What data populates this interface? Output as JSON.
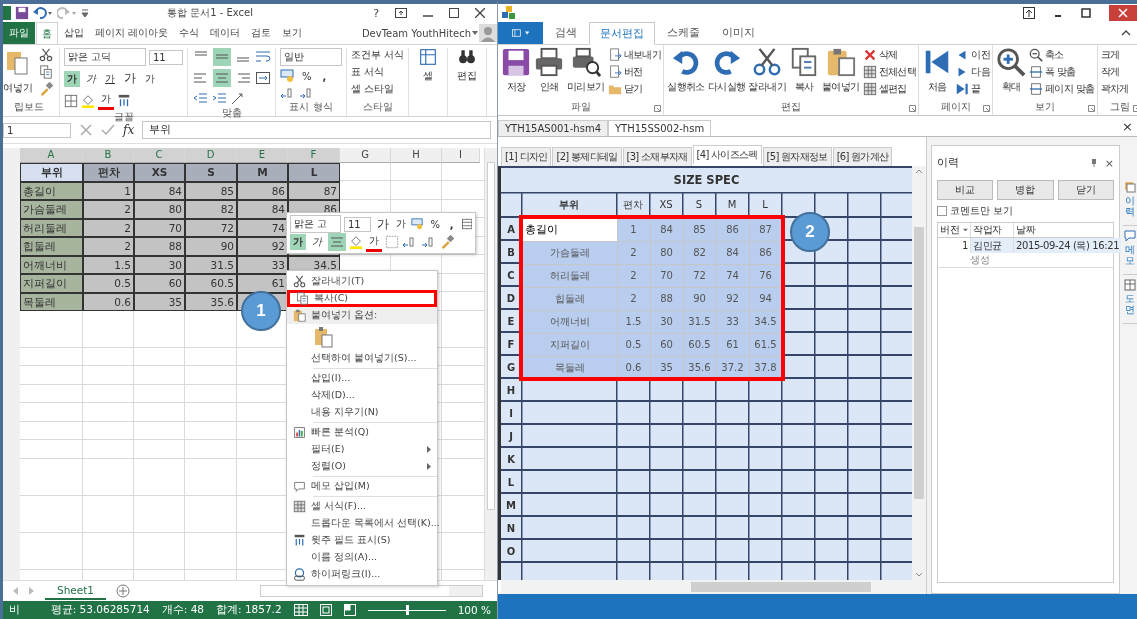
{
  "excel": {
    "title": "통합 문서1 - Excel",
    "help": "?",
    "tabs": [
      {
        "label": "파일",
        "selected": false
      },
      {
        "label": "홈",
        "selected": true
      },
      {
        "label": "삽입",
        "selected": false
      },
      {
        "label": "페이지 레이아웃",
        "selected": false
      },
      {
        "label": "수식",
        "selected": false
      },
      {
        "label": "데이터",
        "selected": false
      },
      {
        "label": "검토",
        "selected": false
      },
      {
        "label": "보기",
        "selected": false
      }
    ],
    "account": "DevTeam YouthHitech",
    "ribbon": {
      "clipboard": {
        "paste": "여넣기",
        "group": "립보드"
      },
      "font": {
        "name": "맑은 고딕",
        "size": "11",
        "group": "글꼴",
        "style_buttons": [
          {
            "label": "가",
            "selected": true
          },
          {
            "label": "가",
            "selected": false
          },
          {
            "label": "가",
            "selected": false
          }
        ],
        "size_buttons": [
          "가",
          "가"
        ],
        "color_button": "가"
      },
      "alignment": {
        "group": "맞춤",
        "vertical": [
          {
            "selected": false
          },
          {
            "selected": true
          },
          {
            "selected": false
          }
        ],
        "horizontal": [
          {
            "selected": false
          },
          {
            "selected": true
          },
          {
            "selected": false
          }
        ]
      },
      "number": {
        "format": "일반",
        "percent": "%",
        "comma": ",",
        "group": "표시 형식"
      },
      "styles": {
        "items": [
          "조건부 서식",
          "표 서식",
          "셀 스타일"
        ],
        "group": "스타일"
      },
      "cells": "셀",
      "editing": "편집"
    },
    "formula_bar": {
      "name_box": "1",
      "fx": "fx",
      "value": "부위"
    },
    "columns": [
      {
        "label": "A",
        "selected": true
      },
      {
        "label": "B",
        "selected": true
      },
      {
        "label": "C",
        "selected": true
      },
      {
        "label": "D",
        "selected": true
      },
      {
        "label": "E",
        "selected": true
      },
      {
        "label": "F",
        "selected": true
      },
      {
        "label": "G",
        "selected": false
      },
      {
        "label": "H",
        "selected": false
      },
      {
        "label": "I",
        "selected": false
      }
    ],
    "rows": [
      {
        "cells": [
          "부위",
          "편차",
          "XS",
          "S",
          "M",
          "L"
        ]
      },
      {
        "cells": [
          "총길이",
          "1",
          "84",
          "85",
          "86",
          "87"
        ]
      },
      {
        "cells": [
          "가슴둘레",
          "2",
          "80",
          "82",
          "84",
          "86"
        ]
      },
      {
        "cells": [
          "허리둘레",
          "2",
          "70",
          "72",
          "74"
        ]
      },
      {
        "cells": [
          "힙둘레",
          "2",
          "88",
          "90",
          "92"
        ]
      },
      {
        "cells": [
          "어깨너비",
          "1.5",
          "30",
          "31.5",
          "33",
          "34.5"
        ]
      },
      {
        "cells": [
          "지퍼길이",
          "0.5",
          "60",
          "60.5",
          "61"
        ]
      },
      {
        "cells": [
          "목둘레",
          "0.6",
          "35",
          "35.6"
        ]
      }
    ],
    "mini_toolbar": {
      "font": "맑은 고",
      "size": "11",
      "grow": "가",
      "shrink": "가",
      "percent": "%",
      "comma": ",",
      "bold": {
        "label": "가",
        "selected": true
      },
      "italic": {
        "label": "가",
        "selected": false
      },
      "center": {
        "selected": true
      },
      "color_button": "가"
    },
    "context_menu": [
      {
        "kind": "item",
        "label": "잘라내기(T)",
        "highlighted": false,
        "submenu": false
      },
      {
        "kind": "item",
        "label": "복사(C)",
        "highlighted": true,
        "submenu": false
      },
      {
        "kind": "header",
        "label": "붙여넣기 옵션:"
      },
      {
        "kind": "paste-options"
      },
      {
        "kind": "item",
        "label": "선택하여 붙여넣기(S)...",
        "highlighted": false,
        "submenu": false
      },
      {
        "kind": "separator"
      },
      {
        "kind": "item",
        "label": "삽입(I)...",
        "highlighted": false,
        "submenu": false
      },
      {
        "kind": "item",
        "label": "삭제(D)...",
        "highlighted": false,
        "submenu": false
      },
      {
        "kind": "item",
        "label": "내용 지우기(N)",
        "highlighted": false,
        "submenu": false
      },
      {
        "kind": "separator"
      },
      {
        "kind": "item",
        "label": "빠른 분석(Q)",
        "highlighted": false,
        "submenu": false
      },
      {
        "kind": "item",
        "label": "필터(E)",
        "highlighted": false,
        "submenu": true
      },
      {
        "kind": "item",
        "label": "정렬(O)",
        "highlighted": false,
        "submenu": true
      },
      {
        "kind": "separator"
      },
      {
        "kind": "item",
        "label": "메모 삽입(M)",
        "highlighted": false,
        "submenu": false
      },
      {
        "kind": "separator"
      },
      {
        "kind": "item",
        "label": "셀 서식(F)...",
        "highlighted": false,
        "submenu": false
      },
      {
        "kind": "item",
        "label": "드롭다운 목록에서 선택(K)...",
        "highlighted": false,
        "submenu": false
      },
      {
        "kind": "item",
        "label": "윗주 필드 표시(S)",
        "highlighted": false,
        "submenu": false
      },
      {
        "kind": "item",
        "label": "이름 정의(A)...",
        "highlighted": false,
        "submenu": false
      },
      {
        "kind": "item",
        "label": "하이퍼링크(I)...",
        "highlighted": false,
        "submenu": false
      }
    ],
    "sheet_tabs": [
      {
        "label": "Sheet1",
        "selected": true
      }
    ],
    "status_bar": {
      "mode": "비",
      "average": "평균: 53.06285714",
      "count": "개수: 48",
      "sum": "합계: 1857.2",
      "zoom": "100 %",
      "zoom_slider": {
        "level": 0.5
      }
    }
  },
  "app": {
    "tabs": [
      {
        "label": "검색",
        "selected": false
      },
      {
        "label": "문서편집",
        "selected": true
      },
      {
        "label": "스케줄",
        "selected": false
      },
      {
        "label": "이미지",
        "selected": false
      }
    ],
    "ribbon": [
      {
        "label": "파일",
        "large": [
          "저장",
          "인쇄",
          "미리보기"
        ],
        "small": [
          "내보내기",
          "버전",
          "닫기"
        ]
      },
      {
        "label": "편집",
        "large": [
          "실행취소",
          "다시실행",
          "잘라내기",
          "복사",
          "붙여넣기"
        ],
        "small": [
          "삭제",
          "전체선택",
          "셀편집"
        ]
      },
      {
        "label": "페이지",
        "large": [
          "처음"
        ],
        "small": [
          "이전",
          "다음",
          "끝"
        ]
      },
      {
        "label": "보기",
        "large": [
          "확대"
        ],
        "small": [
          "축소",
          "폭 맞춤",
          "페이지 맞춤"
        ]
      },
      {
        "label": "그림",
        "small": [
          "크게",
          "작게",
          "꽉차게"
        ]
      }
    ],
    "doc_tabs": [
      {
        "label": "YTH15AS001-hsm4",
        "selected": false
      },
      {
        "label": "YTH15SS002-hsm",
        "selected": true
      }
    ],
    "close": "×",
    "sub_tabs": [
      {
        "label": "[1] 디자인",
        "selected": false
      },
      {
        "label": "[2] 봉제디테일",
        "selected": false
      },
      {
        "label": "[3] 소재부자재",
        "selected": false
      },
      {
        "label": "[4] 사이즈스펙",
        "selected": true
      },
      {
        "label": "[5] 원자재정보",
        "selected": false
      },
      {
        "label": "[6] 원가계산",
        "selected": false
      }
    ],
    "size_spec": {
      "title": "SIZE SPEC",
      "columns": [
        "부위",
        "편차",
        "XS",
        "S",
        "M",
        "L"
      ],
      "highlight_frame": true,
      "rows": [
        {
          "row": "A",
          "cells": [
            "총길이",
            "1",
            "84",
            "85",
            "86",
            "87"
          ],
          "active": true,
          "selected": true
        },
        {
          "row": "B",
          "cells": [
            "가슴둘레",
            "2",
            "80",
            "82",
            "84",
            "86"
          ],
          "active": false,
          "selected": true
        },
        {
          "row": "C",
          "cells": [
            "허리둘레",
            "2",
            "70",
            "72",
            "74",
            "76"
          ],
          "active": false,
          "selected": true
        },
        {
          "row": "D",
          "cells": [
            "힙둘레",
            "2",
            "88",
            "90",
            "92",
            "94"
          ],
          "active": false,
          "selected": true
        },
        {
          "row": "E",
          "cells": [
            "어깨너비",
            "1.5",
            "30",
            "31.5",
            "33",
            "34.5"
          ],
          "active": false,
          "selected": true
        },
        {
          "row": "F",
          "cells": [
            "지퍼길이",
            "0.5",
            "60",
            "60.5",
            "61",
            "61.5"
          ],
          "active": false,
          "selected": true
        },
        {
          "row": "G",
          "cells": [
            "목둘레",
            "0.6",
            "35",
            "35.6",
            "37.2",
            "37.8"
          ],
          "active": false,
          "selected": true
        },
        {
          "row": "H"
        },
        {
          "row": "I"
        },
        {
          "row": "J"
        },
        {
          "row": "K"
        },
        {
          "row": "L"
        },
        {
          "row": "M"
        },
        {
          "row": "N"
        },
        {
          "row": "O"
        }
      ]
    },
    "history": {
      "title": "이력",
      "close": "×",
      "buttons": [
        "비교",
        "병합",
        "닫기"
      ],
      "comment_only": {
        "label": "코멘트만 보기",
        "checked": false
      },
      "columns": [
        "버전",
        "작업자",
        "날짜"
      ],
      "rows": [
        {
          "version": "1",
          "author": "김민균",
          "date": "2015-09-24 (목) 16:21",
          "note": "생성",
          "selected": true
        }
      ],
      "side_tabs": [
        "이력",
        "메모",
        "도면"
      ]
    }
  },
  "callouts": [
    "1",
    "2"
  ]
}
